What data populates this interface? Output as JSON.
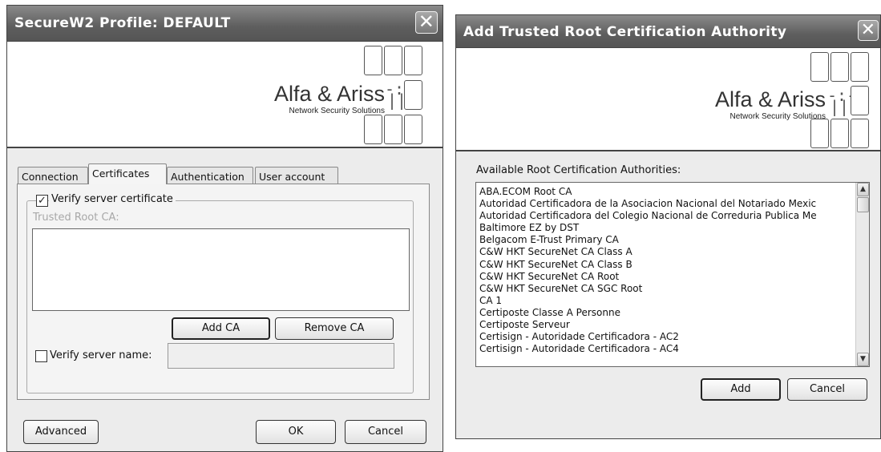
{
  "profile_dialog": {
    "title": "SecureW2 Profile: DEFAULT",
    "close_glyph": "✕",
    "logo": {
      "name": "Alfa & Ariss",
      "tagline": "Network Security Solutions",
      "mark": "-:-\n||"
    },
    "tabs": [
      {
        "label": "Connection"
      },
      {
        "label": "Certificates"
      },
      {
        "label": "Authentication"
      },
      {
        "label": "User account"
      }
    ],
    "active_tab": "Certificates",
    "verify_certificate": {
      "label": "Verify server certificate",
      "checked": true,
      "check_glyph": "✓"
    },
    "trusted_root_label": "Trusted Root CA:",
    "add_ca_label": "Add CA",
    "remove_ca_label": "Remove CA",
    "verify_name": {
      "label": "Verify server name:",
      "checked": false,
      "value": ""
    },
    "advanced_label": "Advanced",
    "ok_label": "OK",
    "cancel_label": "Cancel"
  },
  "add_ca_dialog": {
    "title": "Add Trusted Root Certification Authority",
    "close_glyph": "✕",
    "logo": {
      "name": "Alfa & Ariss",
      "tagline": "Network Security Solutions",
      "mark": "-:-\n||"
    },
    "list_label": "Available Root Certification Authorities:",
    "authorities": [
      "ABA.ECOM Root CA",
      "Autoridad Certificadora de la Asociacion Nacional del Notariado Mexic",
      "Autoridad Certificadora del Colegio Nacional de Correduria Publica Me",
      "Baltimore EZ by DST",
      "Belgacom E-Trust Primary CA",
      "C&W HKT SecureNet CA Class A",
      "C&W HKT SecureNet CA Class B",
      "C&W HKT SecureNet CA Root",
      "C&W HKT SecureNet CA SGC Root",
      "CA 1",
      "Certiposte Classe A Personne",
      "Certiposte Serveur",
      "Certisign - Autoridade Certificadora - AC2",
      "Certisign - Autoridade Certificadora - AC4"
    ],
    "scroll_up_glyph": "▲",
    "scroll_down_glyph": "▼",
    "add_label": "Add",
    "cancel_label": "Cancel"
  }
}
